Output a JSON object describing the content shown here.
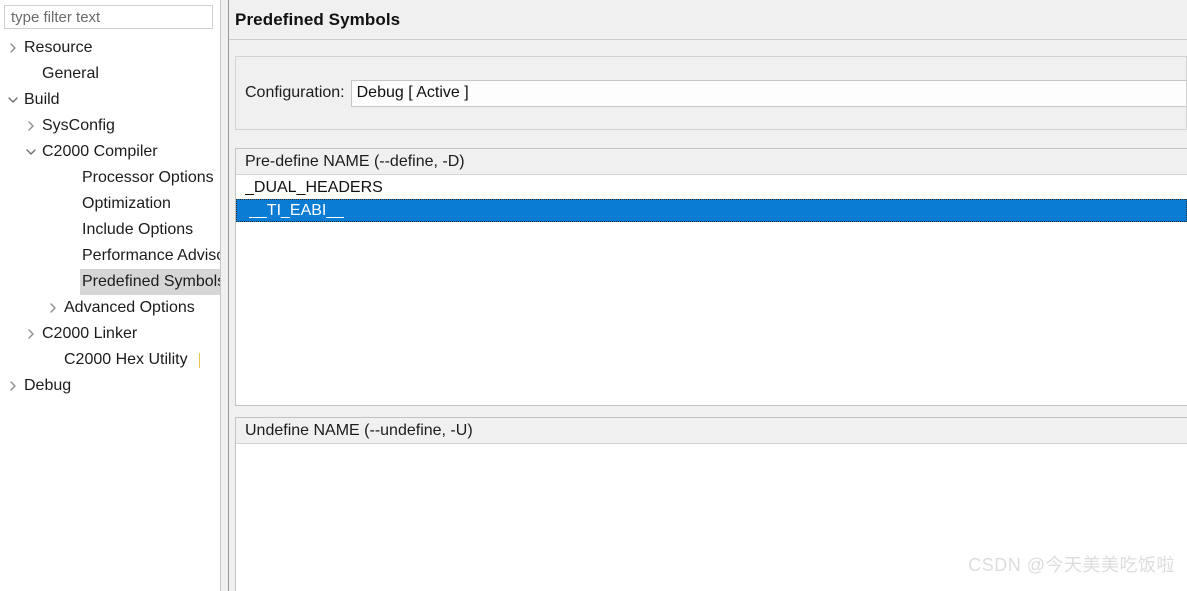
{
  "filter": {
    "placeholder": "type filter text",
    "value": ""
  },
  "tree": {
    "items": [
      {
        "label": "Resource",
        "level": 0,
        "twisty": "chevron-right-icon",
        "selected": false
      },
      {
        "label": "General",
        "level": 1,
        "twisty": "none",
        "selected": false
      },
      {
        "label": "Build",
        "level": 0,
        "twisty": "chevron-down-icon",
        "selected": false
      },
      {
        "label": "SysConfig",
        "level": 1,
        "twisty": "chevron-right-icon",
        "selected": false
      },
      {
        "label": "C2000 Compiler",
        "level": 1,
        "twisty": "chevron-down-icon",
        "selected": false
      },
      {
        "label": "Processor Options",
        "level": 3,
        "twisty": "none",
        "selected": false
      },
      {
        "label": "Optimization",
        "level": 3,
        "twisty": "none",
        "selected": false
      },
      {
        "label": "Include Options",
        "level": 3,
        "twisty": "none",
        "selected": false
      },
      {
        "label": "Performance Advisor",
        "level": 3,
        "twisty": "none",
        "selected": false
      },
      {
        "label": "Predefined Symbols",
        "level": 3,
        "twisty": "none",
        "selected": true
      },
      {
        "label": "Advanced Options",
        "level": 2,
        "twisty": "chevron-right-icon",
        "selected": false
      },
      {
        "label": "C2000 Linker",
        "level": 1,
        "twisty": "chevron-right-icon",
        "selected": false
      },
      {
        "label": "C2000 Hex Utility",
        "level": 2,
        "twisty": "none",
        "selected": false
      },
      {
        "label": "Debug",
        "level": 0,
        "twisty": "chevron-right-icon",
        "selected": false
      }
    ]
  },
  "page": {
    "title": "Predefined Symbols"
  },
  "config": {
    "label": "Configuration:",
    "value": "Debug  [ Active ]"
  },
  "predefine": {
    "header": "Pre-define NAME (--define, -D)",
    "items": [
      {
        "text": "_DUAL_HEADERS",
        "selected": false
      },
      {
        "text": "__TI_EABI__",
        "selected": true
      }
    ]
  },
  "undefine": {
    "header": "Undefine NAME (--undefine, -U)",
    "items": []
  },
  "watermark": {
    "text": "CSDN @今天美美吃饭啦"
  },
  "colors": {
    "selection_blue": "#0a7cd4",
    "tree_selection_gray": "#d6d6d6",
    "panel_bg": "#f0f0f0"
  }
}
